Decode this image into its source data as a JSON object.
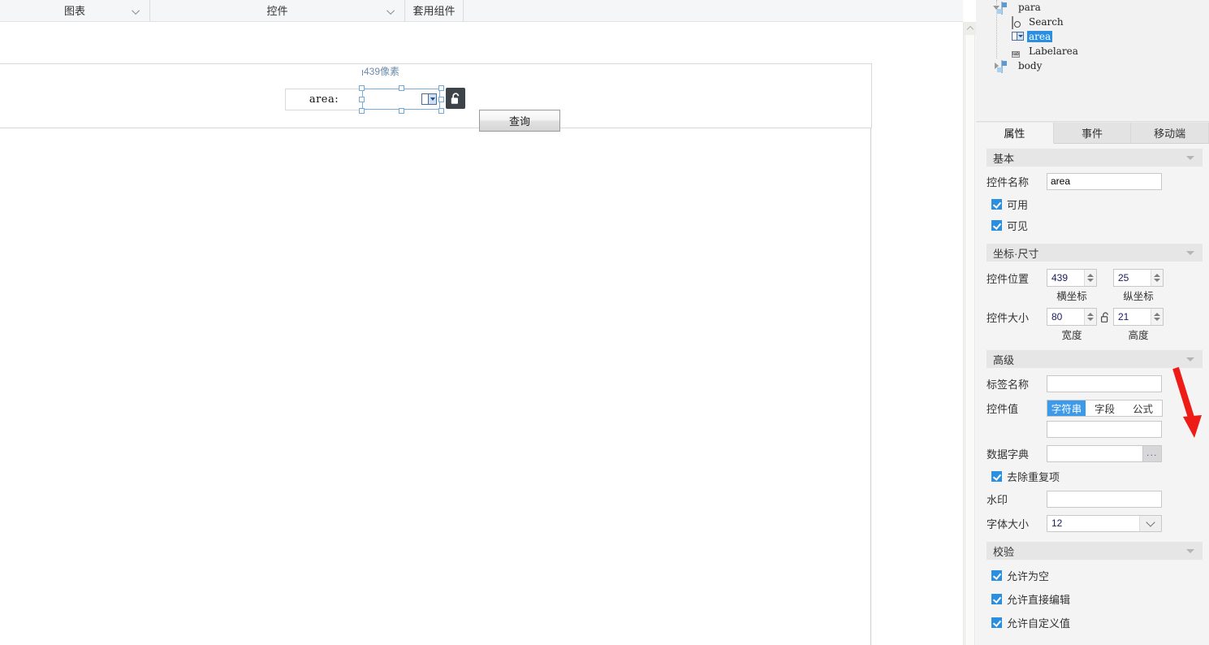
{
  "toolbar": {
    "groups": [
      {
        "label": "图表",
        "icon": "chevron-down-icon"
      },
      {
        "label": "控件",
        "icon": "chevron-down-icon"
      },
      {
        "label": "套用组件",
        "icon": "none"
      }
    ]
  },
  "canvas": {
    "size_hint": "439像素",
    "label_widget": "area:",
    "query_button": "查询",
    "combo_icon": "dropdown-icon",
    "lock_icon": "unlock-icon"
  },
  "tree": {
    "nodes": [
      {
        "label": "para",
        "icon": "folder-icon",
        "toggle": "expanded",
        "indent": 0,
        "selected": false
      },
      {
        "label": "Search",
        "icon": "search-doc-icon",
        "toggle": "none",
        "indent": 1,
        "selected": false
      },
      {
        "label": "area",
        "icon": "combo-icon",
        "toggle": "none",
        "indent": 1,
        "selected": true
      },
      {
        "label": "Labelarea",
        "icon": "label-icon",
        "toggle": "none",
        "indent": 1,
        "selected": false
      },
      {
        "label": "body",
        "icon": "folder-icon",
        "toggle": "collapsed",
        "indent": 0,
        "selected": false
      }
    ]
  },
  "tabs": [
    {
      "label": "属性",
      "active": true
    },
    {
      "label": "事件",
      "active": false
    },
    {
      "label": "移动端",
      "active": false
    }
  ],
  "sections": {
    "basic": {
      "title": "基本",
      "name_label": "控件名称",
      "name_value": "area",
      "checkboxes": [
        {
          "label": "可用",
          "checked": true
        },
        {
          "label": "可见",
          "checked": true
        }
      ]
    },
    "geometry": {
      "title": "坐标·尺寸",
      "position_label": "控件位置",
      "position_x": "439",
      "position_y": "25",
      "position_x_sub": "横坐标",
      "position_y_sub": "纵坐标",
      "size_label": "控件大小",
      "size_w": "80",
      "size_h": "21",
      "size_w_sub": "宽度",
      "size_h_sub": "高度",
      "ratio_lock_icon": "unlock-icon"
    },
    "advanced": {
      "title": "高级",
      "tag_label": "标签名称",
      "tag_value": "",
      "value_label": "控件值",
      "value_modes": [
        {
          "label": "字符串",
          "selected": true
        },
        {
          "label": "字段",
          "selected": false
        },
        {
          "label": "公式",
          "selected": false
        }
      ],
      "value_text": "",
      "dict_label": "数据字典",
      "dict_value": "",
      "dict_button": "...",
      "dedupe_label": "去除重复项",
      "dedupe_checked": true,
      "watermark_label": "水印",
      "watermark_value": "",
      "fontsize_label": "字体大小",
      "fontsize_value": "12"
    },
    "validation": {
      "title": "校验",
      "checkboxes": [
        {
          "label": "允许为空",
          "checked": true
        },
        {
          "label": "允许直接编辑",
          "checked": true
        },
        {
          "label": "允许自定义值",
          "checked": true
        }
      ]
    }
  },
  "annotation": {
    "type": "red-arrow",
    "color": "#ee1c16",
    "points_to": "数据字典 ... 按钮"
  },
  "colors": {
    "accent": "#2a8fe0",
    "segment_on": "#3d9ae8",
    "selection": "#6fa8dc",
    "hint_text": "#6d8ba8"
  }
}
